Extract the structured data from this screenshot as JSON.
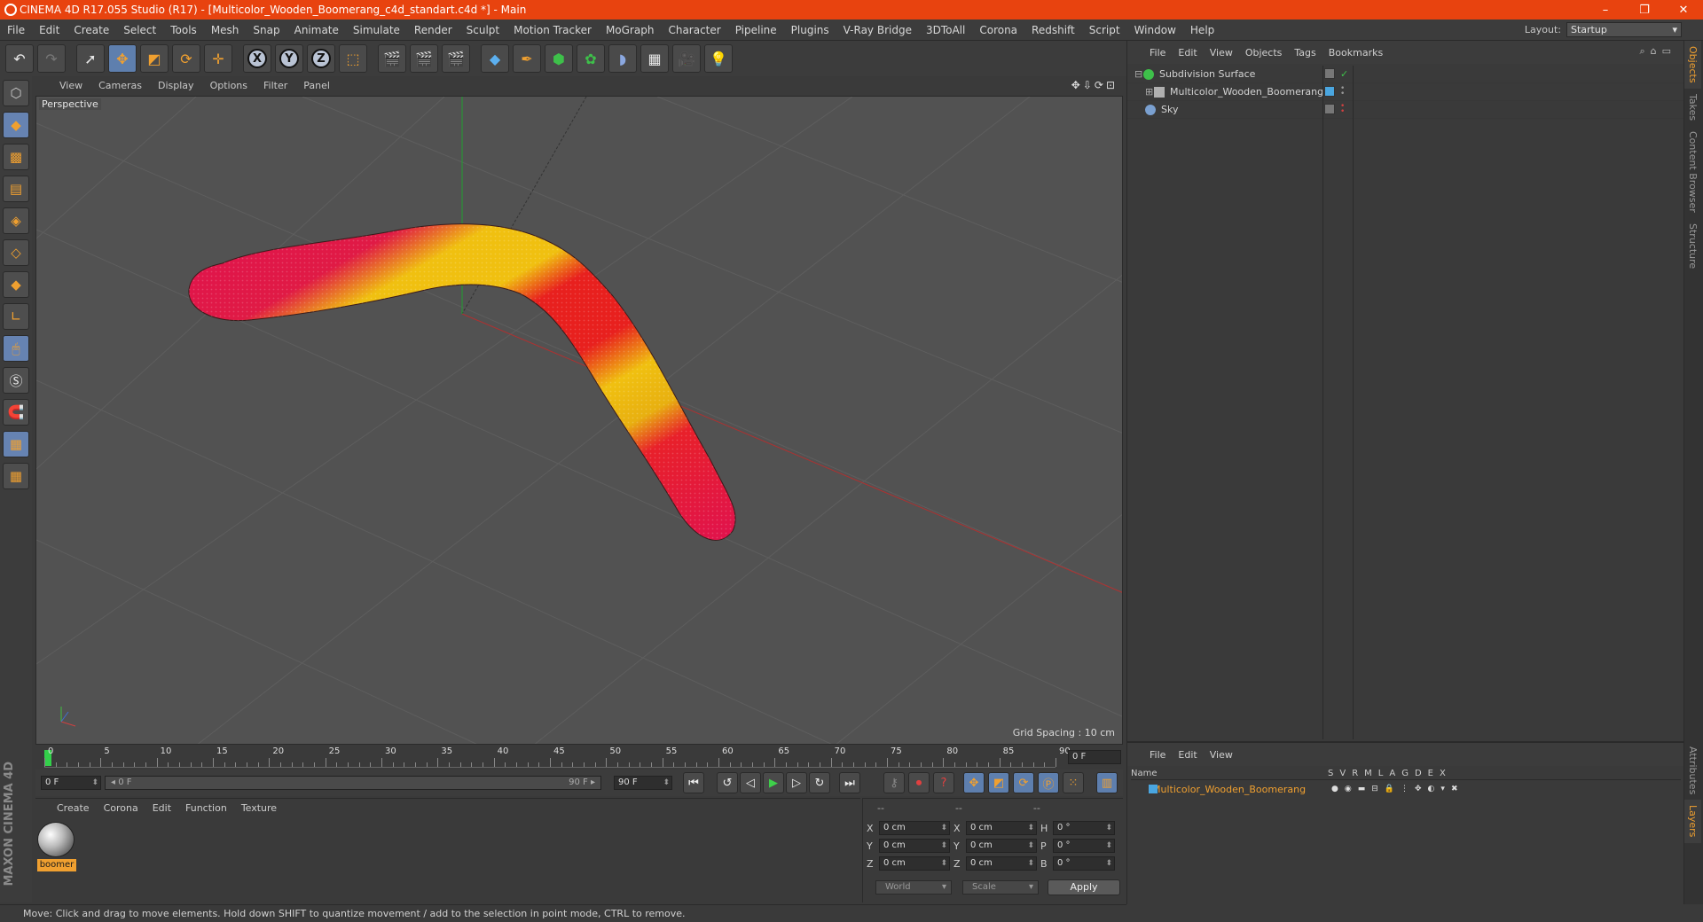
{
  "window": {
    "title": "CINEMA 4D R17.055 Studio (R17) - [Multicolor_Wooden_Boomerang_c4d_standart.c4d *] - Main",
    "minimize": "–",
    "maximize": "❐",
    "close": "✕"
  },
  "menubar": {
    "items": [
      "File",
      "Edit",
      "Create",
      "Select",
      "Tools",
      "Mesh",
      "Snap",
      "Animate",
      "Simulate",
      "Render",
      "Sculpt",
      "Motion Tracker",
      "MoGraph",
      "Character",
      "Pipeline",
      "Plugins",
      "V-Ray Bridge",
      "3DToAll",
      "Corona",
      "Redshift",
      "Script",
      "Window",
      "Help"
    ],
    "layout_label": "Layout:",
    "layout_value": "Startup"
  },
  "axis_labels": [
    "X",
    "Y",
    "Z"
  ],
  "viewport": {
    "menu": [
      "View",
      "Cameras",
      "Display",
      "Options",
      "Filter",
      "Panel"
    ],
    "camera_label": "Perspective",
    "grid_spacing": "Grid Spacing : 10 cm",
    "nav_icons": "✥⇩⟳⊡"
  },
  "timeline": {
    "ticks": [
      "0",
      "5",
      "10",
      "15",
      "20",
      "25",
      "30",
      "35",
      "40",
      "45",
      "50",
      "55",
      "60",
      "65",
      "70",
      "75",
      "80",
      "85",
      "90"
    ],
    "current_frame": "0 F",
    "start_field": "0 F",
    "range_start": "◂ 0 F",
    "range_end": "90 F ▸",
    "end_field": "90 F"
  },
  "materials": {
    "menu": [
      "Create",
      "Corona",
      "Edit",
      "Function",
      "Texture"
    ],
    "items": [
      {
        "name": "boomer"
      }
    ]
  },
  "coords": {
    "header": [
      "--",
      "--",
      "--"
    ],
    "rows": [
      {
        "a": "X",
        "av": "0 cm",
        "b": "X",
        "bv": "0 cm",
        "c": "H",
        "cv": "0 °"
      },
      {
        "a": "Y",
        "av": "0 cm",
        "b": "Y",
        "bv": "0 cm",
        "c": "P",
        "cv": "0 °"
      },
      {
        "a": "Z",
        "av": "0 cm",
        "b": "Z",
        "bv": "0 cm",
        "c": "B",
        "cv": "0 °"
      }
    ],
    "space": "World",
    "mode": "Scale",
    "apply": "Apply"
  },
  "status": "Move: Click and drag to move elements. Hold down SHIFT to quantize movement / add to the selection in point mode, CTRL to remove.",
  "object_manager": {
    "menu": [
      "File",
      "Edit",
      "View",
      "Objects",
      "Tags",
      "Bookmarks"
    ],
    "objects": [
      {
        "name": "Subdivision Surface",
        "icon_color": "#3ec04a",
        "indent": 0
      },
      {
        "name": "Multicolor_Wooden_Boomerang",
        "icon_color": "#b0b0b0",
        "indent": 1
      },
      {
        "name": "Sky",
        "icon_color": "#7aa0d0",
        "indent": 0
      }
    ]
  },
  "right_tabs": [
    "Objects",
    "Takes",
    "Content Browser",
    "Structure"
  ],
  "right_tabs_lower": [
    "Attributes",
    "Layers"
  ],
  "layer_manager": {
    "menu": [
      "File",
      "Edit",
      "View"
    ],
    "col_name": "Name",
    "cols": [
      "S",
      "V",
      "R",
      "M",
      "L",
      "A",
      "G",
      "D",
      "E",
      "X"
    ],
    "layer_name": "Multicolor_Wooden_Boomerang",
    "layer_color": "#4aa6e0"
  },
  "brand": "MAXON CINEMA 4D"
}
